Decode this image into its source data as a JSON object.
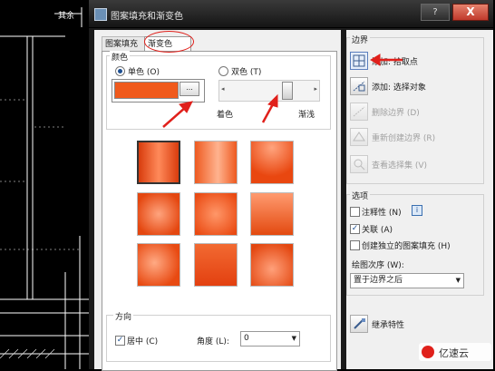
{
  "cad": {
    "label_left": "其余"
  },
  "dialog": {
    "title": "图案填充和渐变色",
    "help_label": "?",
    "close_label": "X"
  },
  "tabs": [
    {
      "label": "图案填充",
      "active": false
    },
    {
      "label": "渐变色",
      "active": true
    }
  ],
  "color": {
    "group_title": "颜色",
    "single_label": "单色 (O)",
    "double_label": "双色 (T)",
    "single_selected": true,
    "swatch_color": "#f05a1c",
    "browse_label": "...",
    "shade_label": "着色",
    "tint_label": "渐浅",
    "slider_fraction": 0.7
  },
  "gradient_tiles": [
    {
      "type": "linear-h",
      "selected": true
    },
    {
      "type": "cylinder",
      "selected": false
    },
    {
      "type": "radial-top",
      "selected": false
    },
    {
      "type": "spherical",
      "selected": false
    },
    {
      "type": "hemispherical",
      "selected": false
    },
    {
      "type": "curved",
      "selected": false
    },
    {
      "type": "radial-left",
      "selected": false
    },
    {
      "type": "linear-v",
      "selected": false
    },
    {
      "type": "inv-radial",
      "selected": false
    }
  ],
  "orientation": {
    "group_title": "方向",
    "centered_label": "居中 (C)",
    "centered_checked": true,
    "angle_label": "角度 (L):",
    "angle_value": "0"
  },
  "boundaries": {
    "group_title": "边界",
    "items": [
      {
        "label": "添加: 拾取点",
        "icon": "pick-point-icon",
        "enabled": true
      },
      {
        "label": "添加: 选择对象",
        "icon": "select-objects-icon",
        "enabled": true
      },
      {
        "label": "删除边界 (D)",
        "icon": "remove-boundary-icon",
        "enabled": false
      },
      {
        "label": "重新创建边界 (R)",
        "icon": "recreate-boundary-icon",
        "enabled": false
      },
      {
        "label": "查看选择集 (V)",
        "icon": "view-selection-icon",
        "enabled": false
      }
    ]
  },
  "options": {
    "group_title": "选项",
    "annotative_label": "注释性 (N)",
    "annotative_checked": false,
    "info_label": "i",
    "associative_label": "关联 (A)",
    "associative_checked": true,
    "separate_label": "创建独立的图案填充 (H)",
    "separate_checked": false,
    "draw_order_label": "绘图次序 (W):",
    "draw_order_value": "置于边界之后"
  },
  "inherit": {
    "label": "继承特性"
  },
  "watermark": {
    "text": "亿速云"
  },
  "colors": {
    "accent": "#f05a1c",
    "annotation_red": "#e0201b"
  }
}
